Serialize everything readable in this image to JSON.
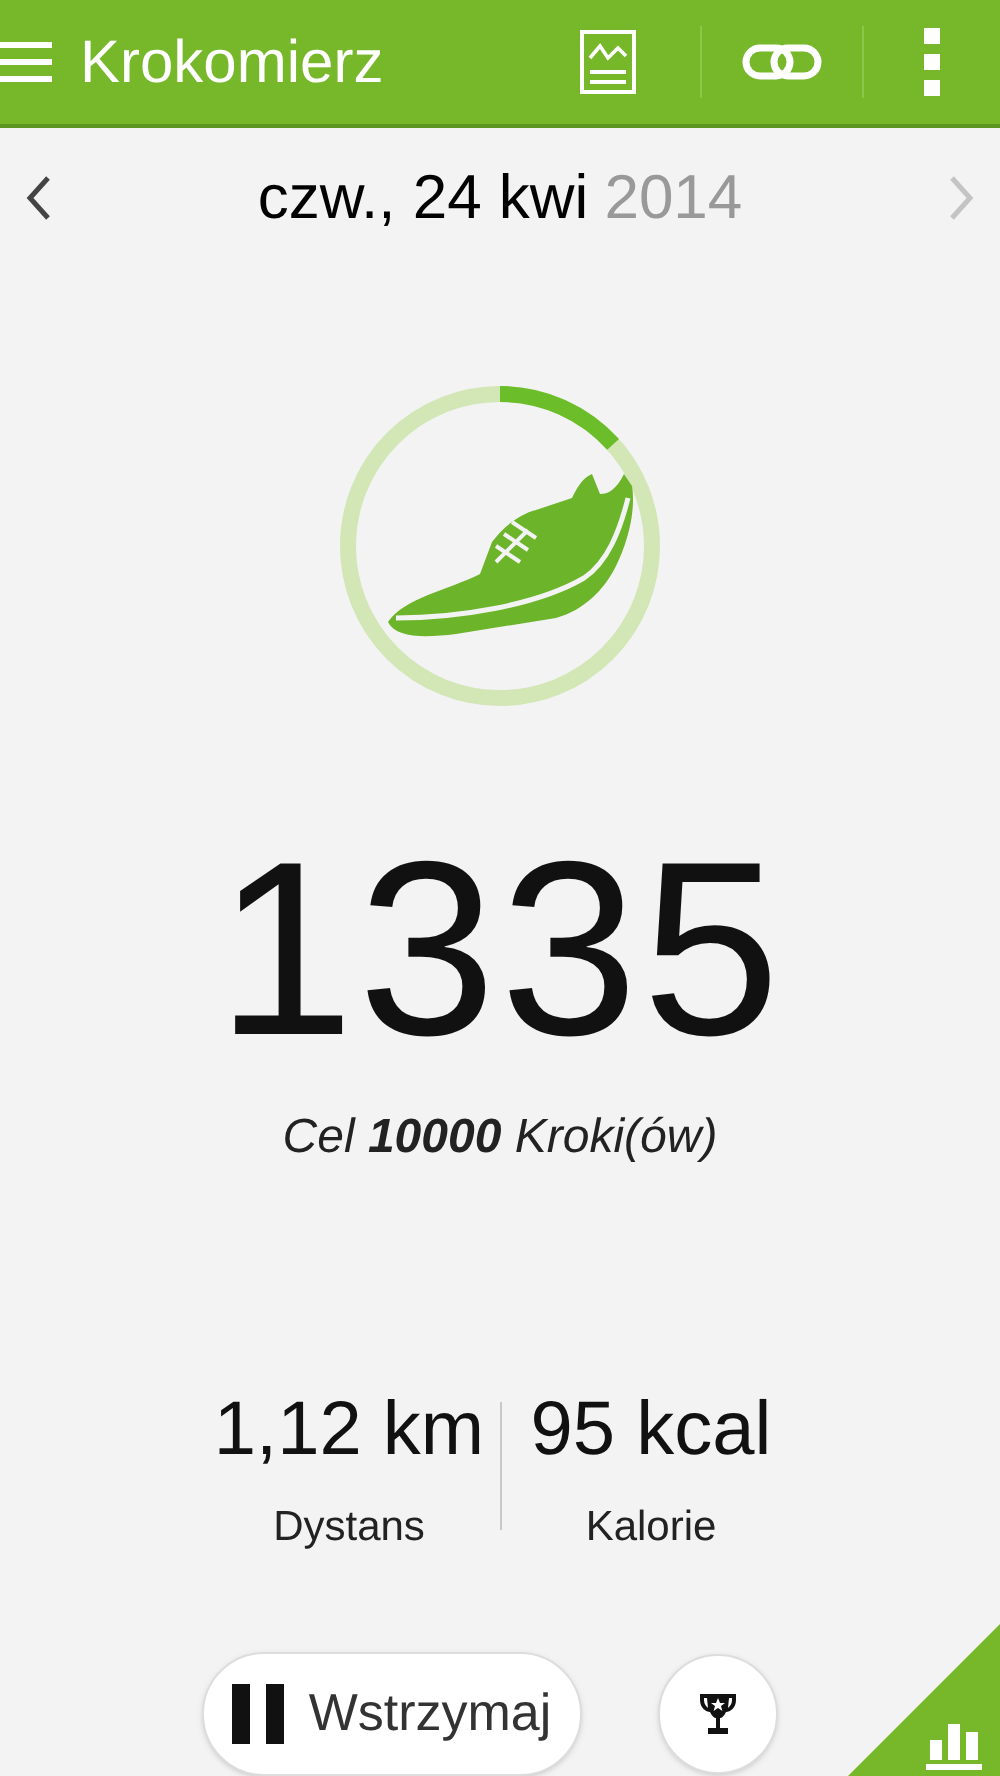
{
  "app_bar": {
    "title": "Krokomierz"
  },
  "date_nav": {
    "date": "czw., 24 kwi",
    "year": "2014",
    "prev_disabled": false,
    "next_disabled": true
  },
  "progress": {
    "level": 0.1335
  },
  "steps": {
    "count": "1335",
    "goal": "Cel **10000** Kroki(ów)"
  },
  "stats": [
    {
      "value": "1,12 km",
      "label": "Dystans"
    },
    {
      "value": "95 kcal",
      "label": "Kalorie"
    }
  ],
  "pause_button": {
    "label": "Wstrzymaj"
  }
}
